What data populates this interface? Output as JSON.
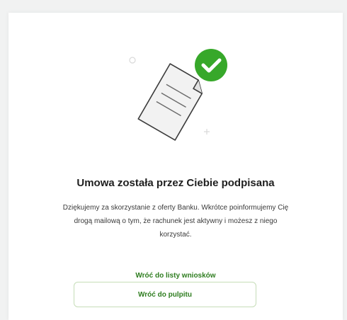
{
  "confirmation": {
    "title": "Umowa została przez Ciebie podpisana",
    "description": "Dziękujemy za skorzystanie z oferty Banku. Wkrótce poinformujemy Cię drogą mailową o tym, że rachunek jest aktywny i możesz z niego korzystać.",
    "back_to_list_label": "Wróć do listy wniosków",
    "back_to_dashboard_label": "Wróć do pulpitu"
  },
  "icons": {
    "document": "document-icon",
    "success": "checkmark-icon"
  },
  "colors": {
    "accent_green": "#37a82a",
    "link_green": "#2e7d1f",
    "button_border": "#c6ddb8"
  }
}
